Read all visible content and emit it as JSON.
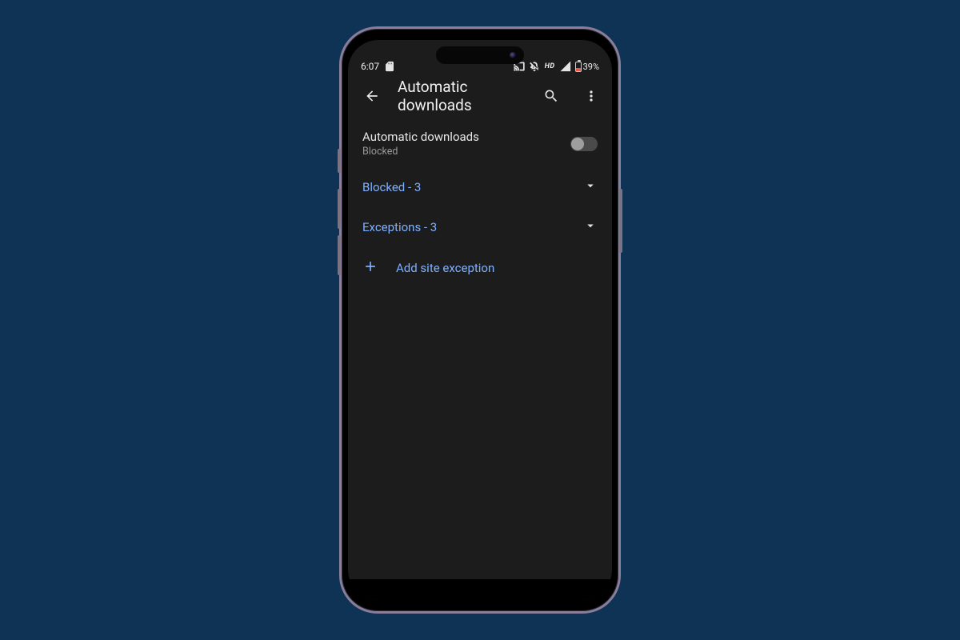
{
  "statusbar": {
    "time": "6:07",
    "hd_label": "HD",
    "battery_pct": "39%"
  },
  "appbar": {
    "title": "Automatic downloads"
  },
  "toggle": {
    "title": "Automatic downloads",
    "subtitle": "Blocked"
  },
  "sections": {
    "blocked_label": "Blocked - 3",
    "exceptions_label": "Exceptions - 3"
  },
  "add": {
    "label": "Add site exception"
  },
  "colors": {
    "accent": "#7fb0ff",
    "bg": "#1c1c1c",
    "page": "#0f3355"
  }
}
